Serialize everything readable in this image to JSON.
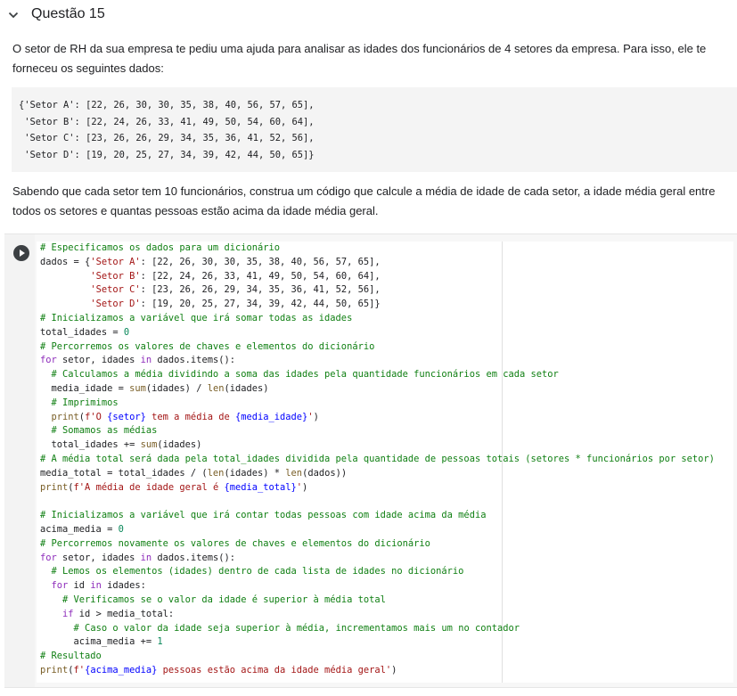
{
  "section": {
    "title": "Questão 15"
  },
  "paragraphs": {
    "intro": "O setor de RH da sua empresa te pediu uma ajuda para analisar as idades dos funcionários de 4 setores da empresa. Para isso, ele te forneceu os seguintes dados:",
    "task": "Sabendo que cada setor tem 10 funcionários, construa um código que calcule a média de idade de cada setor, a idade média geral entre todos os setores e quantas pessoas estão acima da idade média geral."
  },
  "data_block": {
    "lines": [
      "{'Setor A': [22, 26, 30, 30, 35, 38, 40, 56, 57, 65],",
      " 'Setor B': [22, 24, 26, 33, 41, 49, 50, 54, 60, 64],",
      " 'Setor C': [23, 26, 26, 29, 34, 35, 36, 41, 52, 56],",
      " 'Setor D': [19, 20, 25, 27, 34, 39, 42, 44, 50, 65]}"
    ]
  },
  "cell": {
    "run_icon": "play-icon"
  },
  "code": {
    "l1": "# Especificamos os dados para um dicionário",
    "l2_a": "dados = {",
    "l2_s": "'Setor A'",
    "l2_b": ": [22, 26, 30, 30, 35, 38, 40, 56, 57, 65],",
    "l3_s": "'Setor B'",
    "l3_b": ": [22, 24, 26, 33, 41, 49, 50, 54, 60, 64],",
    "l4_s": "'Setor C'",
    "l4_b": ": [23, 26, 26, 29, 34, 35, 36, 41, 52, 56],",
    "l5_s": "'Setor D'",
    "l5_b": ": [19, 20, 25, 27, 34, 39, 42, 44, 50, 65]}",
    "l6": "# Inicializamos a variável que irá somar todas as idades",
    "l7_a": "total_idades = ",
    "l7_n": "0",
    "l8": "# Percorremos os valores de chaves e elementos do dicionário",
    "l9_k": "for",
    "l9_a": " setor, idades ",
    "l9_k2": "in",
    "l9_b": " dados.items():",
    "l10": "# Calculamos a média dividindo a soma das idades pela quantidade funcionários em cada setor",
    "l11_a": "media_idade = ",
    "l11_b1": "sum",
    "l11_c": "(idades) / ",
    "l11_b2": "len",
    "l11_d": "(idades)",
    "l12": "# Imprimimos",
    "l13_b": "print",
    "l13_a": "(",
    "l13_s1": "f'O ",
    "l13_f1": "{setor}",
    "l13_s2": " tem a média de ",
    "l13_f2": "{media_idade}",
    "l13_s3": "'",
    "l13_z": ")",
    "l14": "# Somamos as médias",
    "l15_a": "total_idades += ",
    "l15_b": "sum",
    "l15_c": "(idades)",
    "l16": "# A média total será dada pela total_idades dividida pela quantidade de pessoas totais (setores * funcionários por setor)",
    "l17_a": "media_total = total_idades / (",
    "l17_b1": "len",
    "l17_c": "(idades) * ",
    "l17_b2": "len",
    "l17_d": "(dados))",
    "l18_b": "print",
    "l18_a": "(",
    "l18_s1": "f'A média de idade geral é ",
    "l18_f": "{media_total}",
    "l18_s2": "'",
    "l18_z": ")",
    "l20": "# Inicializamos a variável que irá contar todas pessoas com idade acima da média",
    "l21_a": "acima_media = ",
    "l21_n": "0",
    "l22": "# Percorremos novamente os valores de chaves e elementos do dicionário",
    "l23_k": "for",
    "l23_a": " setor, idades ",
    "l23_k2": "in",
    "l23_b": " dados.items():",
    "l24": "# Lemos os elementos (idades) dentro de cada lista de idades no dicionário",
    "l25_k": "for",
    "l25_a": " id ",
    "l25_k2": "in",
    "l25_b": " idades:",
    "l26": "# Verificamos se o valor da idade é superior à média total",
    "l27_k": "if",
    "l27_a": " id > media_total:",
    "l28": "# Caso o valor da idade seja superior à média, incrementamos mais um no contador",
    "l29_a": "acima_media += ",
    "l29_n": "1",
    "l30": "# Resultado",
    "l31_b": "print",
    "l31_a": "(",
    "l31_s1": "f'",
    "l31_f": "{acima_media}",
    "l31_s2": " pessoas estão acima da idade média geral'",
    "l31_z": ")"
  }
}
